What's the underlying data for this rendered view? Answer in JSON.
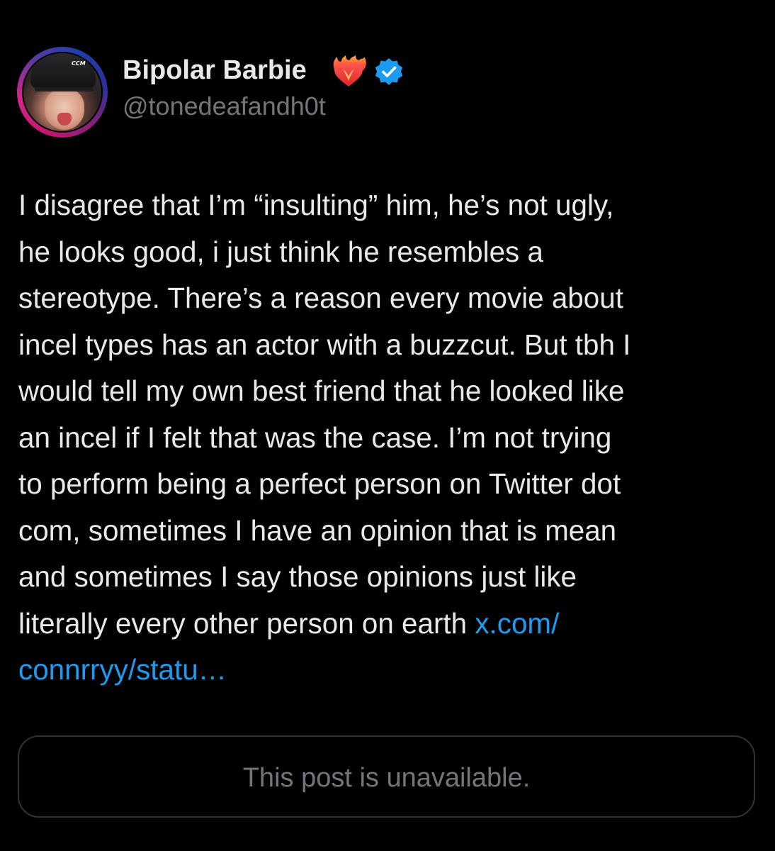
{
  "author": {
    "display_name": "Bipolar Barbie",
    "handle": "@tonedeafandh0t",
    "name_emoji_icon": "heart-on-fire-icon",
    "verified_icon": "verified-badge-icon",
    "verified_color": "#1d9bf0",
    "avatar_helmet_logo": "CCM"
  },
  "tweet": {
    "lines": [
      "I disagree that I’m “insulting” him, he’s not ugly,",
      "he looks good, i just think he resembles a",
      "stereotype. There’s a reason every movie about",
      "incel types has an actor with a buzzcut. But tbh I",
      "would tell my own best friend that he looked like",
      "an incel if I felt that was the case. I’m not trying",
      "to perform being a perfect person on Twitter dot",
      "com, sometimes I have an opinion that is mean",
      "and sometimes I say those opinions just like",
      "literally every other person on earth "
    ],
    "link_part_1": "x.com/",
    "link_part_2": "connrryy/statu…",
    "link_color": "#1d9bf0",
    "text_color": "#e7e9ea"
  },
  "quote_card": {
    "message": "This post is unavailable."
  },
  "colors": {
    "background": "#000000",
    "secondary_text": "#71767b",
    "border": "#2f3336"
  }
}
